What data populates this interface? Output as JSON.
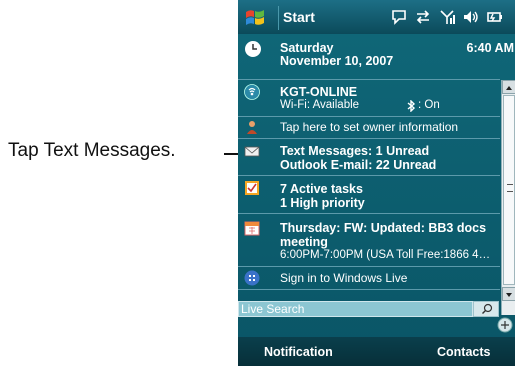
{
  "callout": {
    "label": "Tap Text Messages."
  },
  "titlebar": {
    "start_label": "Start"
  },
  "today": {
    "date_line1": "Saturday",
    "date_line2": "November 10, 2007",
    "time": "6:40 AM",
    "wifi_line1": "KGT-ONLINE",
    "wifi_line2": "Wi-Fi: Available",
    "bt_status": ": On",
    "owner": "Tap here to set owner information",
    "messages_line1": "Text Messages: 1 Unread",
    "messages_line2": "Outlook E-mail: 22 Unread",
    "tasks_line1": "7 Active tasks",
    "tasks_line2": "1 High priority",
    "cal_line1": "Thursday: FW: Updated: BB3 docs",
    "cal_line2": "meeting",
    "cal_line3": "6:00PM-7:00PM (USA Toll Free:1866 4…",
    "windows_live": "Sign in to Windows Live",
    "search_placeholder": "Live Search"
  },
  "bottombar": {
    "left": "Notification",
    "right": "Contacts"
  },
  "colors": {
    "background": "#0e5e6f",
    "titlebar": "#0b4a5a",
    "text": "#ffffff"
  }
}
